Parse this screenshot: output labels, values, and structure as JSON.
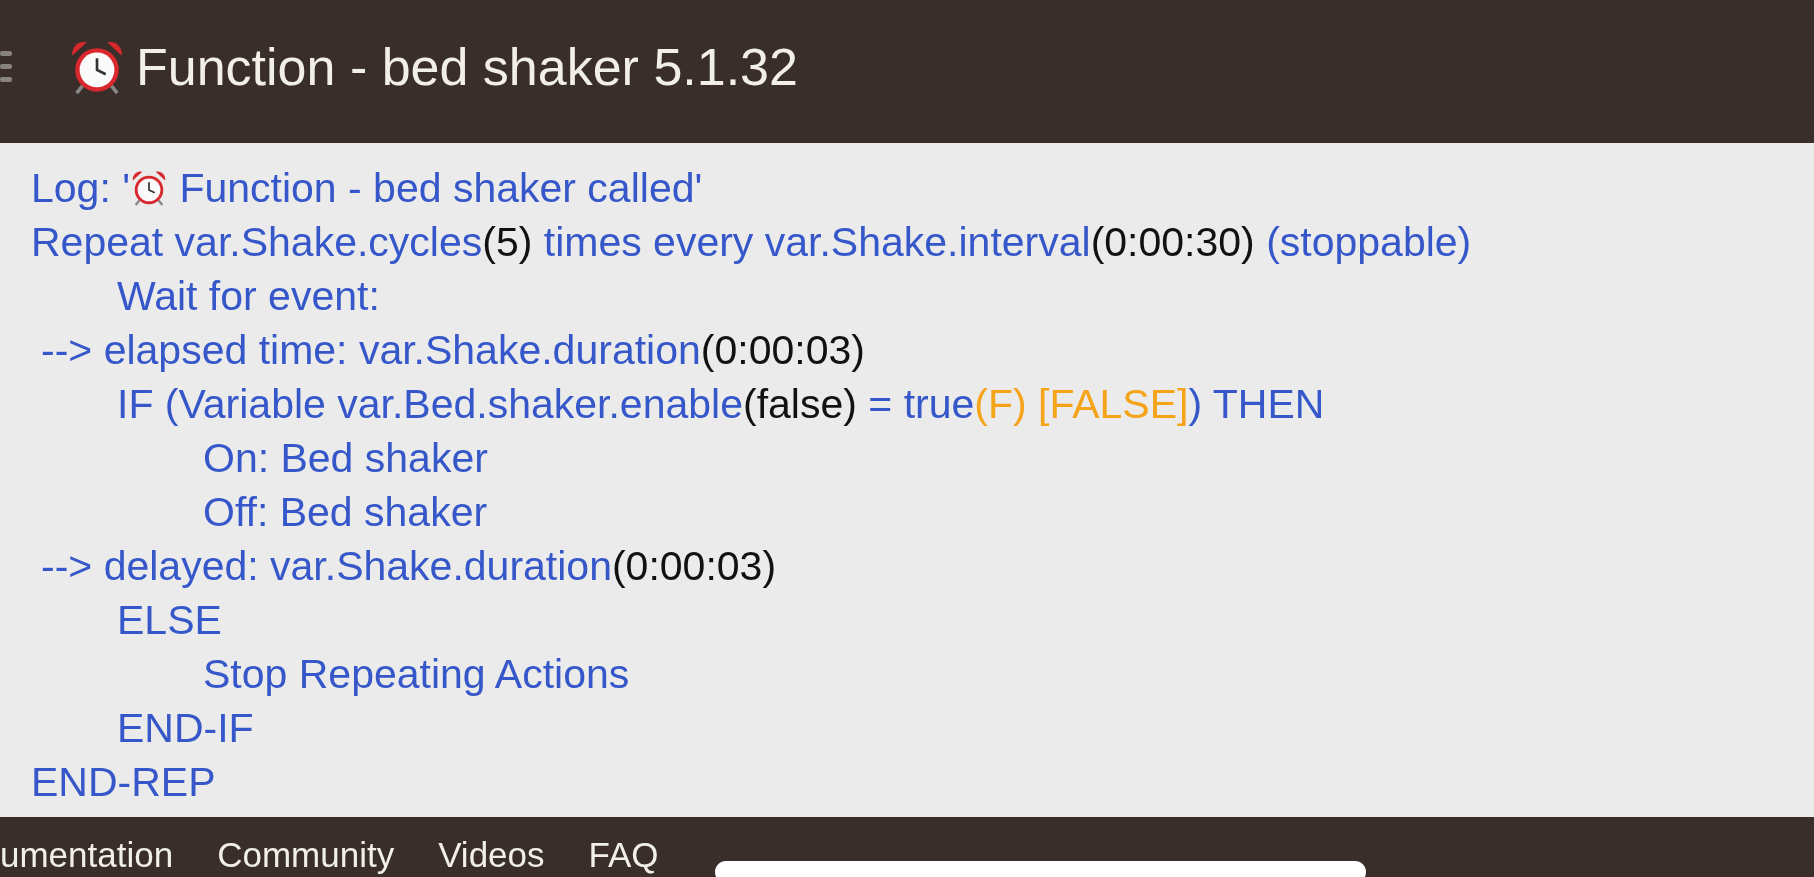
{
  "header": {
    "title": "Function - bed shaker 5.1.32"
  },
  "actions": [
    {
      "kind": "line",
      "segments": [
        {
          "kind": "action",
          "text": "Log: '"
        },
        {
          "kind": "clock"
        },
        {
          "kind": "action",
          "text": " Function - bed shaker called'"
        }
      ]
    },
    {
      "kind": "line",
      "segments": [
        {
          "kind": "action",
          "text": "Repeat var.Shake.cycles"
        },
        {
          "kind": "value",
          "text": "(5)"
        },
        {
          "kind": "action",
          "text": " times every var.Shake.interval"
        },
        {
          "kind": "value",
          "text": "(0:00:30)"
        },
        {
          "kind": "action",
          "text": " (stoppable)"
        }
      ],
      "children": [
        {
          "kind": "line",
          "segments": [
            {
              "kind": "action",
              "text": "Wait for event:"
            }
          ]
        },
        {
          "kind": "event",
          "segments": [
            {
              "kind": "action",
              "text": "--> elapsed time: var.Shake.duration"
            },
            {
              "kind": "value",
              "text": "(0:00:03)"
            }
          ]
        },
        {
          "kind": "line",
          "segments": [
            {
              "kind": "action",
              "text": "IF (Variable var.Bed.shaker.enable"
            },
            {
              "kind": "value",
              "text": "(false)"
            },
            {
              "kind": "action",
              "text": " = true"
            },
            {
              "kind": "state",
              "text": "(F) [FALSE]"
            },
            {
              "kind": "action",
              "text": ") THEN"
            }
          ],
          "children": [
            {
              "kind": "line",
              "segments": [
                {
                  "kind": "action",
                  "text": "On: Bed shaker"
                }
              ]
            },
            {
              "kind": "line",
              "segments": [
                {
                  "kind": "action",
                  "text": "Off: Bed shaker"
                }
              ]
            }
          ]
        },
        {
          "kind": "event",
          "segments": [
            {
              "kind": "action",
              "text": "--> delayed: var.Shake.duration"
            },
            {
              "kind": "value",
              "text": "(0:00:03)"
            }
          ]
        },
        {
          "kind": "line",
          "segments": [
            {
              "kind": "action",
              "text": "ELSE"
            }
          ],
          "children": [
            {
              "kind": "line",
              "segments": [
                {
                  "kind": "action",
                  "text": "Stop Repeating Actions"
                }
              ]
            }
          ]
        },
        {
          "kind": "line",
          "segments": [
            {
              "kind": "action",
              "text": "END-IF"
            }
          ]
        }
      ]
    },
    {
      "kind": "line",
      "segments": [
        {
          "kind": "action",
          "text": "END-REP"
        }
      ]
    }
  ],
  "footer": {
    "links": [
      "umentation",
      "Community",
      "Videos",
      "FAQ"
    ]
  }
}
